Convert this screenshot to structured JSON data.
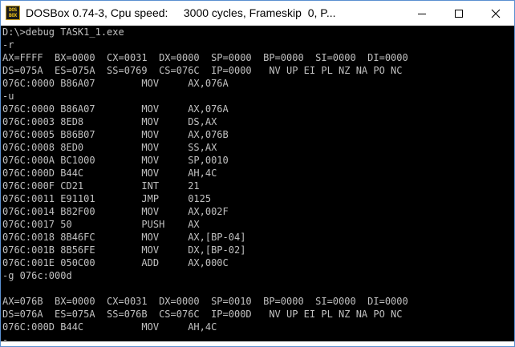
{
  "window": {
    "title": "DOSBox 0.74-3, Cpu speed:     3000 cycles, Frameskip  0, P...",
    "icon_text_top": "DOS",
    "icon_text_bottom": "BOX",
    "icons": {
      "app": "dosbox-app-icon",
      "minimize": "minimize-icon",
      "maximize": "maximize-icon",
      "close": "close-icon"
    }
  },
  "terminal": {
    "lines": [
      "D:\\>debug TASK1_1.exe",
      "-r",
      "AX=FFFF  BX=0000  CX=0031  DX=0000  SP=0000  BP=0000  SI=0000  DI=0000",
      "DS=075A  ES=075A  SS=0769  CS=076C  IP=0000   NV UP EI PL NZ NA PO NC",
      "076C:0000 B86A07        MOV     AX,076A",
      "-u",
      "076C:0000 B86A07        MOV     AX,076A",
      "076C:0003 8ED8          MOV     DS,AX",
      "076C:0005 B86B07        MOV     AX,076B",
      "076C:0008 8ED0          MOV     SS,AX",
      "076C:000A BC1000        MOV     SP,0010",
      "076C:000D B44C          MOV     AH,4C",
      "076C:000F CD21          INT     21",
      "076C:0011 E91101        JMP     0125",
      "076C:0014 B82F00        MOV     AX,002F",
      "076C:0017 50            PUSH    AX",
      "076C:0018 8B46FC        MOV     AX,[BP-04]",
      "076C:001B 8B56FE        MOV     DX,[BP-02]",
      "076C:001E 050C00        ADD     AX,000C",
      "-g 076c:000d",
      "",
      "AX=076B  BX=0000  CX=0031  DX=0000  SP=0010  BP=0000  SI=0000  DI=0000",
      "DS=076A  ES=075A  SS=076B  CS=076C  IP=000D   NV UP EI PL NZ NA PO NC",
      "076C:000D B44C          MOV     AH,4C",
      "-_"
    ],
    "colors": {
      "background": "#000000",
      "text": "#c0c0c0"
    }
  }
}
